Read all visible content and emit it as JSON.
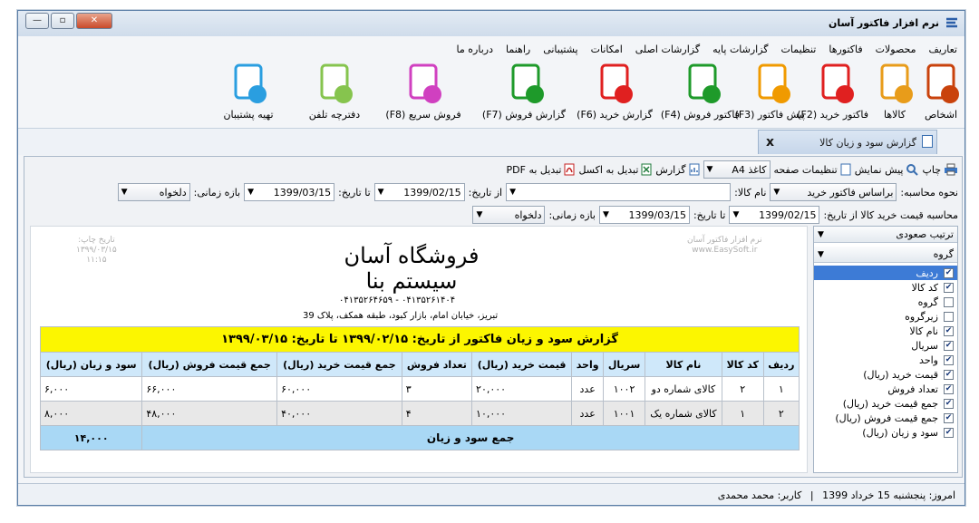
{
  "window": {
    "title": "نرم افزار فاکتور آسان"
  },
  "menu": [
    "تعاریف",
    "محصولات",
    "فاکتورها",
    "تنظیمات",
    "گزارشات پایه",
    "گزارشات اصلی",
    "امکانات",
    "پشتیبانی",
    "راهنما",
    "درباره ما"
  ],
  "ribbon": [
    {
      "label": "اشخاص",
      "icon": "person-icon",
      "color": "#c9420c"
    },
    {
      "label": "کالاها",
      "icon": "box-icon",
      "color": "#e89c1a"
    },
    {
      "label": "فاکتور خرید (F2)",
      "icon": "purchase-invoice-icon",
      "color": "#e02020"
    },
    {
      "label": "پیش فاکتور (F3)",
      "icon": "proforma-icon",
      "color": "#f09a00"
    },
    {
      "label": "فاکتور فروش (F4)",
      "icon": "sales-invoice-icon",
      "color": "#1e9a2a"
    },
    {
      "label": "گزارش خرید (F6)",
      "icon": "purchase-report-icon",
      "color": "#e02020"
    },
    {
      "label": "گزارش فروش (F7)",
      "icon": "sales-report-icon",
      "color": "#1e9a2a"
    },
    {
      "label": "فروش سریع (F8)",
      "icon": "cart-icon",
      "color": "#d040c0"
    },
    {
      "label": "دفترچه تلفن",
      "icon": "phone-icon",
      "color": "#86c44e"
    },
    {
      "label": "تهیه پشتیبان",
      "icon": "database-icon",
      "color": "#2a9ee0"
    }
  ],
  "tab": {
    "label": "گزارش سود و زیان کالا",
    "close": "x"
  },
  "toolbar": {
    "print": "چاپ",
    "preview": "پیش نمایش",
    "page_settings": "تنظیمات صفحه",
    "paper_value": "کاغذ A4",
    "report": "گزارش",
    "to_excel": "تبدیل به اکسل",
    "to_pdf": "تبدیل به PDF"
  },
  "filter1": {
    "method_label": "نحوه محاسبه:",
    "method_value": "براساس فاکتور خرید",
    "product_label": "نام کالا:",
    "product_value": "",
    "from_label": "از تاریخ:",
    "from_value": "1399/02/15",
    "to_label": "تا تاریخ:",
    "to_value": "1399/03/15",
    "range_label": "بازه زمانی:",
    "range_value": "دلخواه"
  },
  "filter2": {
    "label": "محاسبه قیمت خرید کالا از تاریخ:",
    "from_value": "1399/02/15",
    "to_label": "تا تاریخ:",
    "to_value": "1399/03/15",
    "range_label": "بازه زمانی:",
    "range_value": "دلخواه"
  },
  "report": {
    "store_name": "فروشگاه آسان سیستم بنا",
    "phones": "۰۴۱۳۵۲۶۱۴۰۴ - ۰۴۱۳۵۲۶۴۶۵۹",
    "address": "تبریز، خیابان امام، بازار کبود، طبقه همکف، پلاک 39",
    "print_date_label": "تاریخ چاپ:",
    "print_date": "۱۳۹۹/۰۳/۱۵",
    "print_time": "۱۱:۱۵",
    "brand_line1": "نرم افزار فاکتور آسان",
    "brand_line2": "www.EasySoft.ir",
    "title": "گزارش سود و زیان فاکتور از تاریخ: ۱۳۹۹/۰۲/۱۵ تا تاریخ: ۱۳۹۹/۰۳/۱۵",
    "columns": [
      "ردیف",
      "کد کالا",
      "نام کالا",
      "سریال",
      "واحد",
      "قیمت خرید (ریال)",
      "تعداد فروش",
      "جمع قیمت خرید (ریال)",
      "جمع قیمت فروش (ریال)",
      "سود و زیان (ریال)"
    ],
    "rows": [
      [
        "۱",
        "۲",
        "کالای شماره دو",
        "۱۰۰۲",
        "عدد",
        "۲۰,۰۰۰",
        "۳",
        "۶۰,۰۰۰",
        "۶۶,۰۰۰",
        "۶,۰۰۰"
      ],
      [
        "۲",
        "۱",
        "کالای شماره یک",
        "۱۰۰۱",
        "عدد",
        "۱۰,۰۰۰",
        "۴",
        "۴۰,۰۰۰",
        "۴۸,۰۰۰",
        "۸,۰۰۰"
      ]
    ],
    "total_label": "جمع سود و زیان",
    "total_value": "۱۴,۰۰۰"
  },
  "side": {
    "sort_value": "ترتیب صعودی",
    "group_value": "گروه",
    "fields": [
      {
        "label": "ردیف",
        "checked": true,
        "selected": true
      },
      {
        "label": "کد کالا",
        "checked": true
      },
      {
        "label": "گروه",
        "checked": false
      },
      {
        "label": "زیرگروه",
        "checked": false
      },
      {
        "label": "نام کالا",
        "checked": true
      },
      {
        "label": "سریال",
        "checked": true
      },
      {
        "label": "واحد",
        "checked": true
      },
      {
        "label": "قیمت خرید (ریال)",
        "checked": true
      },
      {
        "label": "تعداد فروش",
        "checked": true
      },
      {
        "label": "جمع قیمت خرید (ریال)",
        "checked": true
      },
      {
        "label": "جمع قیمت فروش (ریال)",
        "checked": true
      },
      {
        "label": "سود و زیان (ریال)",
        "checked": true
      }
    ]
  },
  "status": {
    "today": "امروز: پنجشنبه 15 خرداد 1399",
    "sep": "|",
    "user": "کاربر: محمد محمدی"
  }
}
